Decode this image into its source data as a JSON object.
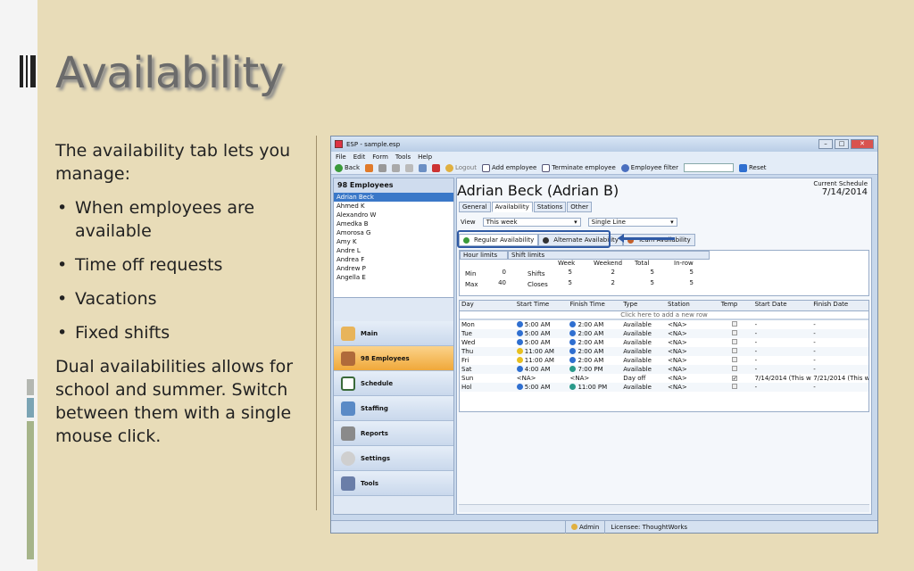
{
  "slide": {
    "title": "Availability",
    "intro": "The availability tab lets you manage:",
    "bullets": [
      "When employees are available",
      "Time off requests",
      "Vacations",
      "Fixed shifts"
    ],
    "outro": "Dual availabilities allows for school and summer. Switch between them with a single mouse click."
  },
  "window": {
    "title": "ESP - sample.esp",
    "menu": [
      "File",
      "Edit",
      "Form",
      "Tools",
      "Help"
    ],
    "toolbar": {
      "back": "Back",
      "logout": "Logout",
      "add": "Add employee",
      "terminate": "Terminate employee",
      "filter": "Employee filter",
      "reset": "Reset"
    },
    "sidebar": {
      "header": "98 Employees",
      "employees": [
        "Adrian Beck",
        "Ahmed K",
        "Alexandro W",
        "Amedka B",
        "Amorosa G",
        "Amy K",
        "Andre L",
        "Andrea F",
        "Andrew P",
        "Angella E"
      ],
      "nav": [
        "Main",
        "98 Employees",
        "Schedule",
        "Staffing",
        "Reports",
        "Settings",
        "Tools"
      ]
    },
    "main": {
      "employee_name": "Adrian Beck (Adrian B)",
      "current_schedule_label": "Current Schedule",
      "current_schedule_date": "7/14/2014",
      "tabs": [
        "General",
        "Availability",
        "Stations",
        "Other"
      ],
      "view_label": "View",
      "view_value": "This week",
      "line_value": "Single Line",
      "subtabs": [
        "Regular Availability",
        "Alternate Availability",
        "Team Availability"
      ],
      "limits": {
        "hour_limits": "Hour limits",
        "shift_limits": "Shift limits",
        "week": "Week",
        "weekend": "Weekend",
        "total": "Total",
        "inrow": "In-row",
        "min": "Min",
        "max": "Max",
        "shifts": "Shifts",
        "closes": "Closes",
        "min_hours": "0",
        "max_hours": "40",
        "shifts_vals": [
          "5",
          "2",
          "5",
          "5"
        ],
        "closes_vals": [
          "5",
          "2",
          "5",
          "5"
        ]
      },
      "grid": {
        "columns": [
          "Day",
          "Start Time",
          "Finish Time",
          "Type",
          "Station",
          "Temp",
          "Start Date",
          "Finish Date"
        ],
        "add_row": "Click here to add a new row",
        "rows": [
          [
            "Mon",
            "5:00 AM",
            "2:00 AM",
            "Available",
            "<NA>",
            "",
            "-",
            "-"
          ],
          [
            "Tue",
            "5:00 AM",
            "2:00 AM",
            "Available",
            "<NA>",
            "",
            "-",
            "-"
          ],
          [
            "Wed",
            "5:00 AM",
            "2:00 AM",
            "Available",
            "<NA>",
            "",
            "-",
            "-"
          ],
          [
            "Thu",
            "11:00 AM",
            "2:00 AM",
            "Available",
            "<NA>",
            "",
            "-",
            "-"
          ],
          [
            "Fri",
            "11:00 AM",
            "2:00 AM",
            "Available",
            "<NA>",
            "",
            "-",
            "-"
          ],
          [
            "Sat",
            "4:00 AM",
            "7:00 PM",
            "Available",
            "<NA>",
            "",
            "-",
            "-"
          ],
          [
            "Sun",
            "<NA>",
            "<NA>",
            "Day off",
            "<NA>",
            "✓",
            "7/14/2014 (This w",
            "7/21/2014 (This w"
          ],
          [
            "Hol",
            "5:00 AM",
            "11:00 PM",
            "Available",
            "<NA>",
            "",
            "-",
            "-"
          ]
        ]
      }
    },
    "status": {
      "user": "Admin",
      "licensee": "Licensee: ThoughtWorks"
    }
  },
  "colors": {
    "accent": "#2f5aa5",
    "nav_active": "#f0a83a",
    "background": "#e8dcb8"
  }
}
